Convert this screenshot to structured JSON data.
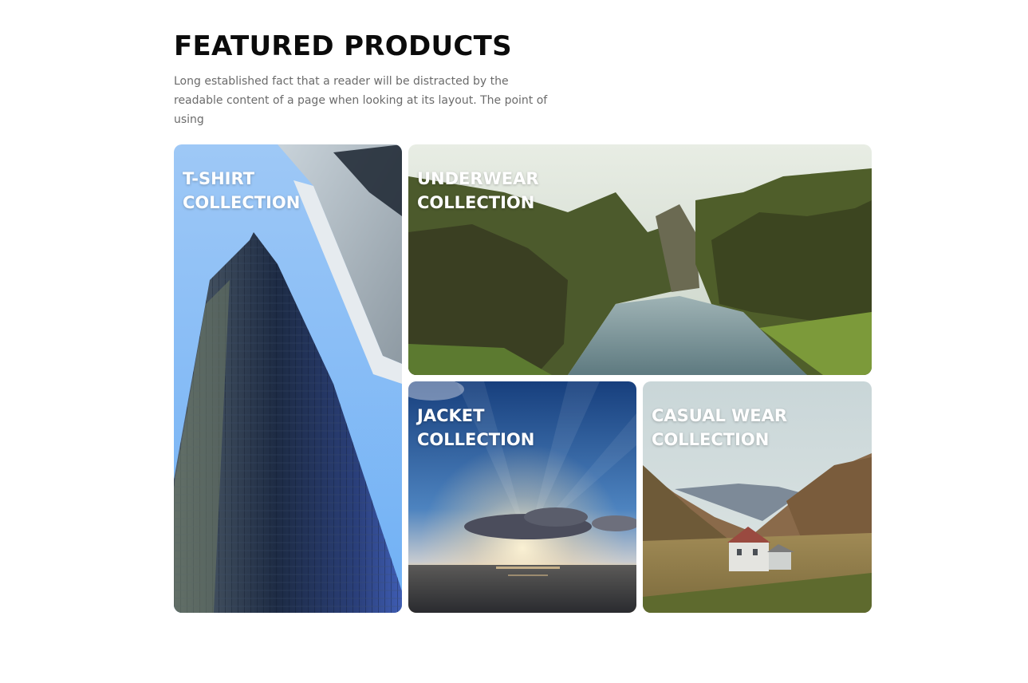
{
  "section": {
    "title": "FEATURED PRODUCTS",
    "description": "Long established fact that a reader will be distracted by the readable content of a page when looking at its layout. The point of using"
  },
  "collections": [
    {
      "line1": "T-SHIRT",
      "line2": "COLLECTION",
      "image": "skyscraper-photo"
    },
    {
      "line1": "UNDERWEAR",
      "line2": "COLLECTION",
      "image": "canyon-river-photo"
    },
    {
      "line1": "JACKET",
      "line2": "COLLECTION",
      "image": "ocean-sunrise-photo"
    },
    {
      "line1": "CASUAL WEAR",
      "line2": "COLLECTION",
      "image": "mountain-house-photo"
    }
  ],
  "colors": {
    "title": "#0b0b0b",
    "description": "#6b6b6b",
    "label": "#ffffff"
  }
}
